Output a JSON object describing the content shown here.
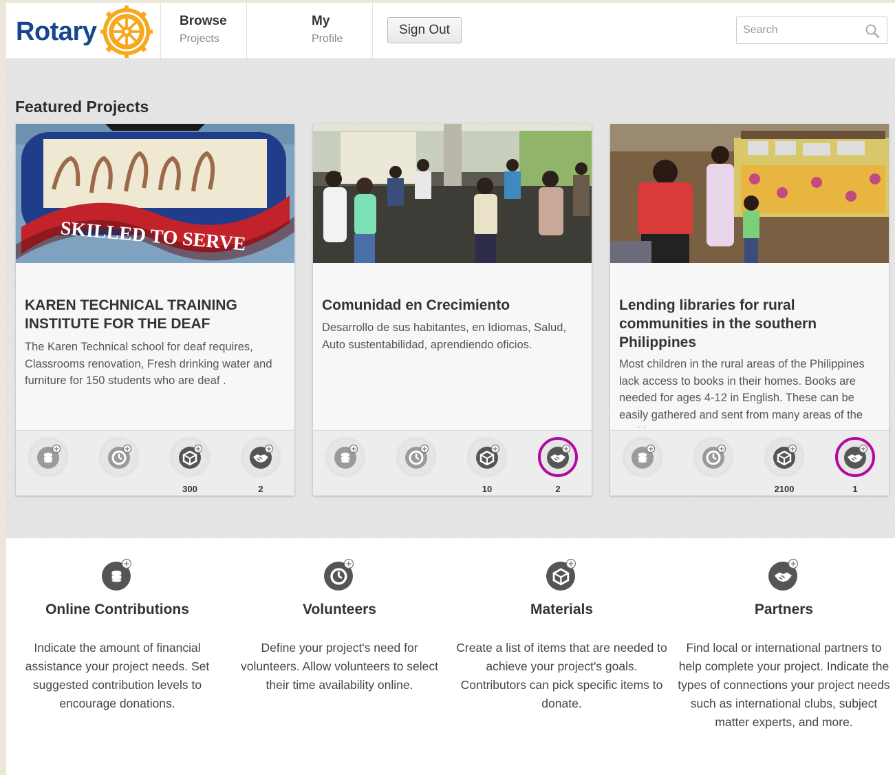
{
  "header": {
    "logo_text": "Rotary",
    "nav": [
      {
        "title": "Browse",
        "sub": "Projects"
      },
      {
        "title": "My",
        "sub": "Profile"
      }
    ],
    "signout_label": "Sign Out",
    "search_placeholder": "Search"
  },
  "featured": {
    "title": "Featured Projects",
    "cards": [
      {
        "title": "KAREN TECHNICAL TRAINING INSTITUTE FOR THE DEAF",
        "description": "The Karen Technical school for deaf requires, Classrooms renovation, Fresh drinking water and furniture for 150 students who are deaf .",
        "image_text": "SKILLED TO SERVE",
        "resources": [
          {
            "icon": "contributions-icon",
            "count": "",
            "highlight": false,
            "active": false
          },
          {
            "icon": "volunteers-icon",
            "count": "",
            "highlight": false,
            "active": false
          },
          {
            "icon": "materials-icon",
            "count": "300",
            "highlight": false,
            "active": true
          },
          {
            "icon": "partners-icon",
            "count": "2",
            "highlight": false,
            "active": true
          }
        ]
      },
      {
        "title": "Comunidad en Crecimiento",
        "description": "Desarrollo de sus habitantes, en Idiomas, Salud, Auto sustentabilidad, aprendiendo oficios.",
        "resources": [
          {
            "icon": "contributions-icon",
            "count": "",
            "highlight": false,
            "active": false
          },
          {
            "icon": "volunteers-icon",
            "count": "",
            "highlight": false,
            "active": false
          },
          {
            "icon": "materials-icon",
            "count": "10",
            "highlight": false,
            "active": true
          },
          {
            "icon": "partners-icon",
            "count": "2",
            "highlight": true,
            "active": true
          }
        ]
      },
      {
        "title": "Lending libraries for rural communities in the southern Philippines",
        "description": "Most children in the rural areas of the Philippines lack access to books in their homes. Books are needed for ages 4-12 in English. These can be easily gathered and sent from many areas of the world.",
        "resources": [
          {
            "icon": "contributions-icon",
            "count": "",
            "highlight": false,
            "active": false
          },
          {
            "icon": "volunteers-icon",
            "count": "",
            "highlight": false,
            "active": false
          },
          {
            "icon": "materials-icon",
            "count": "2100",
            "highlight": false,
            "active": true
          },
          {
            "icon": "partners-icon",
            "count": "1",
            "highlight": true,
            "active": true
          }
        ]
      }
    ]
  },
  "features": [
    {
      "icon": "contributions-icon",
      "title": "Online Contributions",
      "description": "Indicate the amount of financial assistance your project needs. Set suggested contribution levels to encourage donations."
    },
    {
      "icon": "volunteers-icon",
      "title": "Volunteers",
      "description": "Define your project's need for volunteers. Allow volunteers to select their time availability online."
    },
    {
      "icon": "materials-icon",
      "title": "Materials",
      "description": "Create a list of items that are needed to achieve your project's goals. Contributors can pick specific items to donate."
    },
    {
      "icon": "partners-icon",
      "title": "Partners",
      "description": "Find local or international partners to help complete your project. Indicate the types of connections your project needs such as international clubs, subject matter experts, and more."
    }
  ],
  "colors": {
    "brand_blue": "#17458f",
    "rotary_gold": "#f7a81b",
    "highlight_magenta": "#b5089d"
  }
}
